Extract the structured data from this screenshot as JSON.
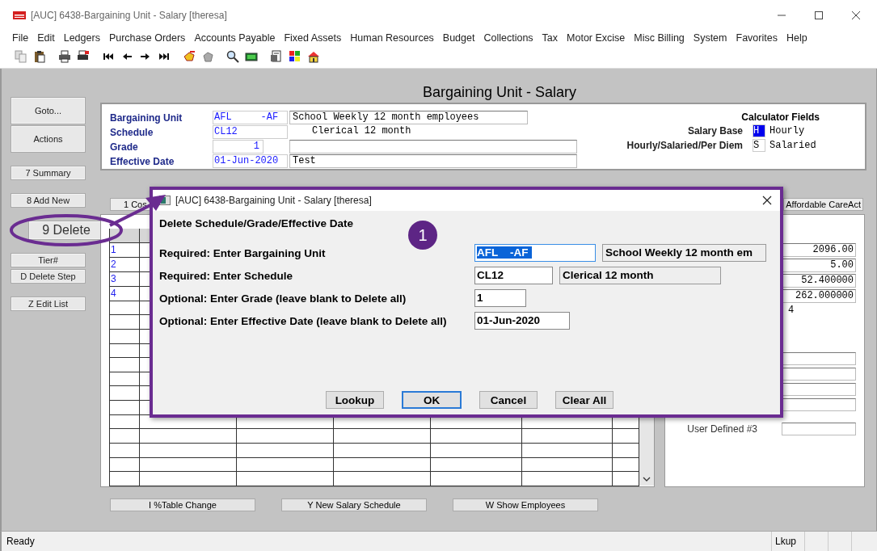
{
  "window": {
    "title": "[AUC] 6438-Bargaining Unit - Salary [theresa]"
  },
  "menu": [
    "File",
    "Edit",
    "Ledgers",
    "Purchase Orders",
    "Accounts Payable",
    "Fixed Assets",
    "Human Resources",
    "Budget",
    "Collections",
    "Tax",
    "Motor Excise",
    "Misc Billing",
    "System",
    "Favorites",
    "Help"
  ],
  "sidebar": {
    "groups": [
      [
        {
          "label": "Goto...",
          "kind": "large"
        },
        {
          "label": "Actions",
          "kind": "large"
        }
      ],
      [
        {
          "label": "7 Summary",
          "kind": "small"
        }
      ],
      [
        {
          "label": "8 Add New",
          "kind": "small"
        },
        {
          "label": "9 Delete",
          "kind": "magnified"
        },
        {
          "label": "Tier#",
          "kind": "small"
        },
        {
          "label": "D Delete Step",
          "kind": "small"
        }
      ],
      [
        {
          "label": "Z Edit List",
          "kind": "small"
        }
      ]
    ]
  },
  "heading": "Bargaining Unit - Salary",
  "header_form": {
    "rows": [
      {
        "label": "Bargaining Unit",
        "value": "AFL     -AF",
        "kind": "text",
        "description": {
          "kind": "box",
          "text": "School Weekly 12 month employees"
        }
      },
      {
        "label": "Schedule",
        "value": "CL12",
        "kind": "text",
        "description": {
          "kind": "plain",
          "text": "Clerical 12 month"
        }
      },
      {
        "label": "Grade",
        "value": "1",
        "kind": "number",
        "description": {
          "kind": "box"
        }
      },
      {
        "label": "Effective Date",
        "value": "01-Jun-2020",
        "kind": "text",
        "description": {
          "kind": "box",
          "text": "Test"
        }
      }
    ],
    "calculator": {
      "title": "Calculator Fields",
      "rows": [
        {
          "label": "Salary Base",
          "code": "H",
          "highlighted": true,
          "meaning": "Hourly"
        },
        {
          "label": "Hourly/Salaried/Per Diem",
          "code": "S",
          "highlighted": false,
          "meaning": "Salaried"
        }
      ]
    }
  },
  "tab_buttons": [
    "1 Cos",
    "Affordable CareAct"
  ],
  "grid": {
    "rows": [
      {
        "number": "1"
      },
      {
        "number": "2"
      },
      {
        "number": "3"
      },
      {
        "number": "4"
      }
    ]
  },
  "details": {
    "values": [
      "2096.00",
      "5.00",
      "52.400000",
      "262.000000"
    ],
    "cut_value": "4",
    "label": "User Defined #3"
  },
  "bottom_buttons": [
    "I  %Table Change",
    "Y New Salary Schedule",
    "W Show Employees"
  ],
  "status_bar": {
    "message": "Ready",
    "panels": [
      "Lkup"
    ]
  },
  "dialog": {
    "title": "[AUC] 6438-Bargaining Unit - Salary [theresa]",
    "heading": "Delete Schedule/Grade/Effective Date",
    "rows": [
      {
        "label": "Required: Enter Bargaining Unit",
        "value": "AFL    -AF",
        "highlighted": true,
        "focused": true,
        "description": "School Weekly 12 month em"
      },
      {
        "label": "Required: Enter Schedule",
        "value": "CL12",
        "highlighted": false,
        "focused": false,
        "description": "Clerical 12 month"
      },
      {
        "label": "Optional: Enter Grade (leave blank to Delete all)",
        "value": "1",
        "highlighted": false,
        "focused": false
      },
      {
        "label": "Optional: Enter Effective Date (leave blank to Delete all)",
        "value": "01-Jun-2020",
        "highlighted": false,
        "focused": false
      }
    ],
    "buttons": [
      {
        "label": "Lookup",
        "focused": false
      },
      {
        "label": "OK",
        "focused": true
      },
      {
        "label": "Cancel",
        "focused": false
      },
      {
        "label": "Clear All",
        "focused": false
      }
    ]
  },
  "callout": {
    "number": "1"
  }
}
